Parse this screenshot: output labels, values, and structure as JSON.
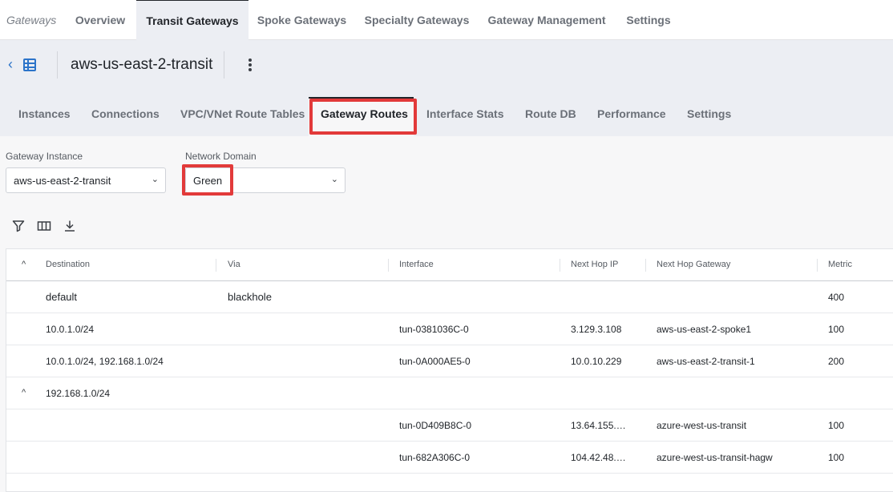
{
  "topnav": {
    "crumb": "Gateways",
    "tabs": [
      "Overview",
      "Transit Gateways",
      "Spoke Gateways",
      "Specialty Gateways",
      "Gateway Management",
      "Settings"
    ],
    "active_tab": "Transit Gateways"
  },
  "header": {
    "title": "aws-us-east-2-transit"
  },
  "subtabs": [
    "Instances",
    "Connections",
    "VPC/VNet Route Tables",
    "Gateway Routes",
    "Interface Stats",
    "Route DB",
    "Performance",
    "Settings"
  ],
  "active_subtab": "Gateway Routes",
  "filters": {
    "gateway_instance": {
      "label": "Gateway Instance",
      "value": "aws-us-east-2-transit"
    },
    "network_domain": {
      "label": "Network Domain",
      "value": "Green"
    }
  },
  "toolbar": {
    "icons": [
      "filter-icon",
      "columns-icon",
      "download-icon"
    ]
  },
  "table": {
    "columns": [
      "Destination",
      "Via",
      "Interface",
      "Next Hop IP",
      "Next Hop Gateway",
      "Metric"
    ],
    "rows": [
      {
        "destination": "default",
        "via": "blackhole",
        "interface": "",
        "next_hop_ip": "",
        "next_hop_gateway": "",
        "metric": "400"
      },
      {
        "destination": "10.0.1.0/24",
        "via": "",
        "interface": "tun-0381036C-0",
        "next_hop_ip": "3.129.3.108",
        "next_hop_gateway": "aws-us-east-2-spoke1",
        "metric": "100"
      },
      {
        "destination": "10.0.1.0/24, 192.168.1.0/24",
        "via": "",
        "interface": "tun-0A000AE5-0",
        "next_hop_ip": "10.0.10.229",
        "next_hop_gateway": "aws-us-east-2-transit-1",
        "metric": "200"
      },
      {
        "destination": "192.168.1.0/24",
        "via": "",
        "interface": "",
        "next_hop_ip": "",
        "next_hop_gateway": "",
        "metric": ""
      },
      {
        "destination": "",
        "via": "",
        "interface": "tun-0D409B8C-0",
        "next_hop_ip": "13.64.155.…",
        "next_hop_gateway": "azure-west-us-transit",
        "metric": "100"
      },
      {
        "destination": "",
        "via": "",
        "interface": "tun-682A306C-0",
        "next_hop_ip": "104.42.48.…",
        "next_hop_gateway": "azure-west-us-transit-hagw",
        "metric": "100"
      }
    ]
  },
  "colors": {
    "accent": "#2c74c9",
    "highlight": "#e23a3a"
  }
}
